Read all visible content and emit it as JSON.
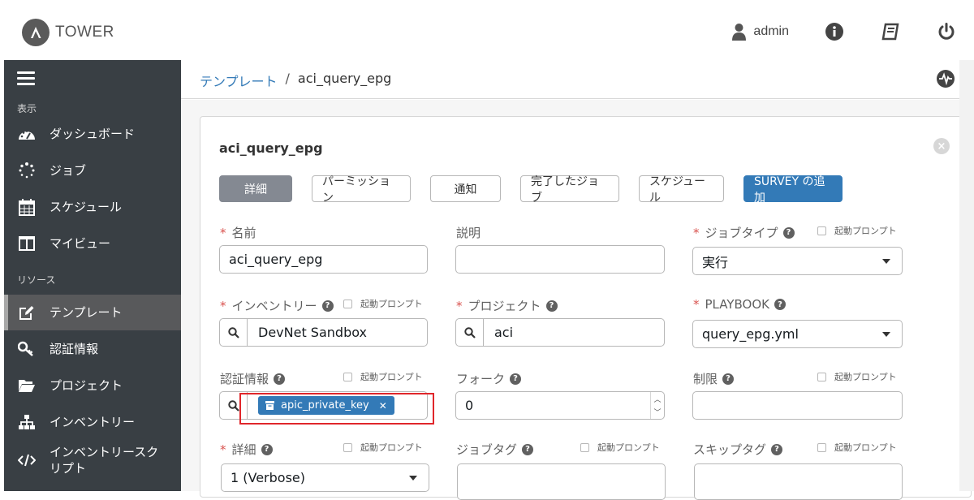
{
  "brand": {
    "name": "TOWER"
  },
  "topbar": {
    "username": "admin"
  },
  "sidebar": {
    "section_view": "表示",
    "section_resources": "リソース",
    "items": [
      {
        "label": "ダッシュボード",
        "icon": "dashboard-icon"
      },
      {
        "label": "ジョブ",
        "icon": "jobs-spinner-icon"
      },
      {
        "label": "スケジュール",
        "icon": "calendar-icon"
      },
      {
        "label": "マイビュー",
        "icon": "columns-icon"
      },
      {
        "label": "テンプレート",
        "icon": "edit-icon",
        "active": true
      },
      {
        "label": "認証情報",
        "icon": "key-icon"
      },
      {
        "label": "プロジェクト",
        "icon": "folder-icon"
      },
      {
        "label": "インベントリー",
        "icon": "sitemap-icon"
      },
      {
        "label": "インベントリースク\nリプト",
        "icon": "code-icon"
      }
    ]
  },
  "breadcrumb": {
    "parent": "テンプレート",
    "separator": "/",
    "current": "aci_query_epg"
  },
  "panel": {
    "title": "aci_query_epg",
    "tabs": [
      "詳細",
      "パーミッション",
      "通知",
      "完了したジョブ",
      "スケジュール",
      "SURVEY の追加"
    ]
  },
  "prompt_label": "起動プロンプト",
  "form": {
    "name": {
      "label": "名前",
      "value": "aci_query_epg"
    },
    "description": {
      "label": "説明",
      "value": ""
    },
    "job_type": {
      "label": "ジョブタイプ",
      "value": "実行"
    },
    "inventory": {
      "label": "インベントリー",
      "value": "DevNet Sandbox"
    },
    "project": {
      "label": "プロジェクト",
      "value": "aci"
    },
    "playbook": {
      "label": "PLAYBOOK",
      "value": "query_epg.yml"
    },
    "credential": {
      "label": "認証情報",
      "chip": "apic_private_key"
    },
    "forks": {
      "label": "フォーク",
      "value": "0"
    },
    "limit": {
      "label": "制限",
      "value": ""
    },
    "verbosity": {
      "label": "詳細",
      "value": "1 (Verbose)"
    },
    "job_tags": {
      "label": "ジョブタグ",
      "value": ""
    },
    "skip_tags": {
      "label": "スキップタグ",
      "value": ""
    }
  }
}
